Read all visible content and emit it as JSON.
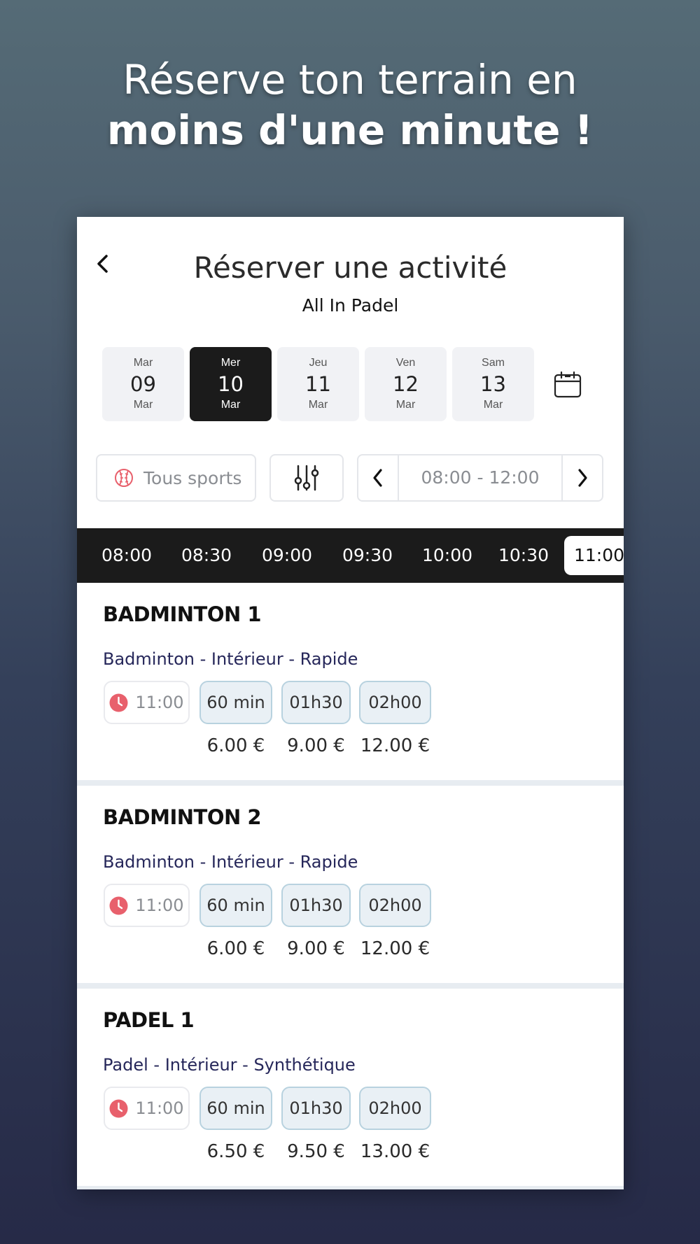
{
  "headline": {
    "line1": "Réserve ton terrain en",
    "line2": "moins d'une minute !"
  },
  "header": {
    "title": "Réserver une activité",
    "subtitle": "All In Padel"
  },
  "dates": [
    {
      "dow": "Mar",
      "num": "09",
      "mon": "Mar",
      "selected": false
    },
    {
      "dow": "Mer",
      "num": "10",
      "mon": "Mar",
      "selected": true
    },
    {
      "dow": "Jeu",
      "num": "11",
      "mon": "Mar",
      "selected": false
    },
    {
      "dow": "Ven",
      "num": "12",
      "mon": "Mar",
      "selected": false
    },
    {
      "dow": "Sam",
      "num": "13",
      "mon": "Mar",
      "selected": false
    }
  ],
  "filters": {
    "sports_label": "Tous sports",
    "time_range": "08:00 - 12:00"
  },
  "time_slots": [
    "08:00",
    "08:30",
    "09:00",
    "09:30",
    "10:00",
    "10:30",
    "11:00"
  ],
  "selected_slot": "11:00",
  "courts": [
    {
      "name": "BADMINTON 1",
      "description": "Badminton - Intérieur  - Rapide",
      "start_time": "11:00",
      "durations": [
        {
          "label": "60 min",
          "price": "6.00 €"
        },
        {
          "label": "01h30",
          "price": "9.00 €"
        },
        {
          "label": "02h00",
          "price": "12.00 €"
        }
      ]
    },
    {
      "name": "BADMINTON 2",
      "description": "Badminton - Intérieur  - Rapide",
      "start_time": "11:00",
      "durations": [
        {
          "label": "60 min",
          "price": "6.00 €"
        },
        {
          "label": "01h30",
          "price": "9.00 €"
        },
        {
          "label": "02h00",
          "price": "12.00 €"
        }
      ]
    },
    {
      "name": "PADEL 1",
      "description": "Padel - Intérieur  - Synthétique",
      "start_time": "11:00",
      "durations": [
        {
          "label": "60 min",
          "price": "6.50 €"
        },
        {
          "label": "01h30",
          "price": "9.50 €"
        },
        {
          "label": "02h00",
          "price": "13.00 €"
        }
      ]
    }
  ],
  "colors": {
    "accent_red": "#e8606c",
    "dark": "#1b1b1b",
    "duration_bg": "#e9f0f5",
    "duration_border": "#b8d2df",
    "description_text": "#26275a"
  },
  "icons": {
    "back": "chevron-left-icon",
    "calendar": "calendar-icon",
    "sport": "baseball-icon",
    "settings": "sliders-icon",
    "prev": "chevron-left-icon",
    "next": "chevron-right-icon",
    "clock": "clock-icon"
  }
}
